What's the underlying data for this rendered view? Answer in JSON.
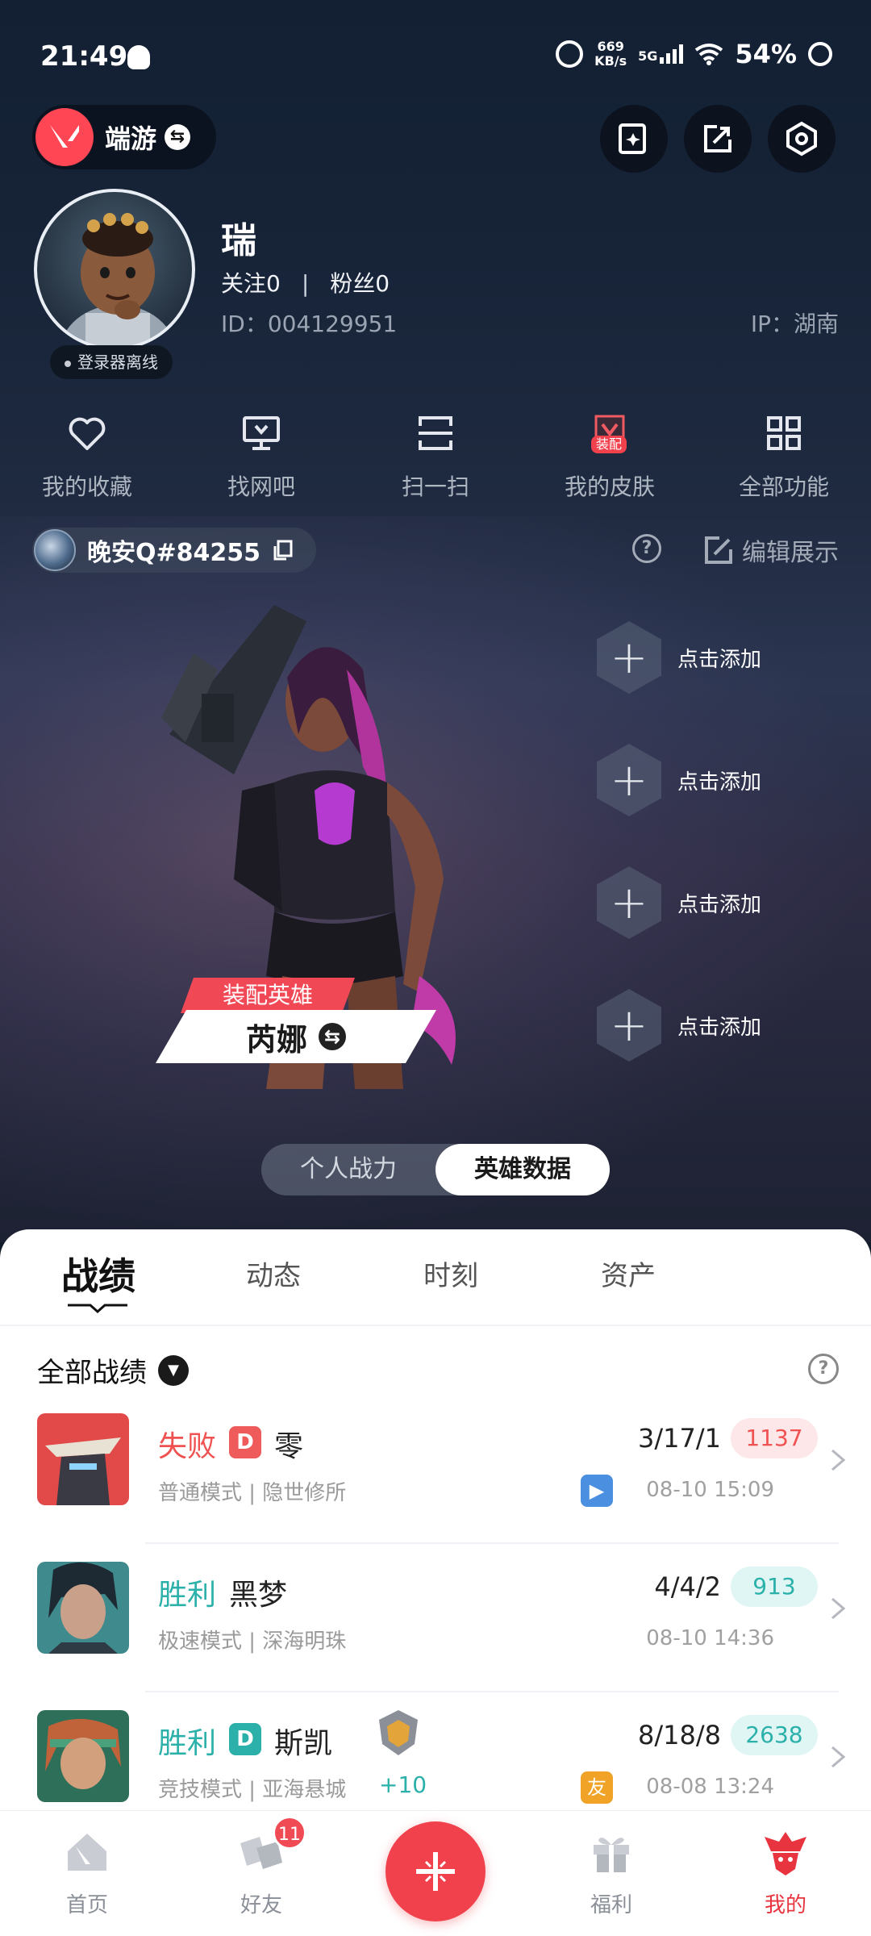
{
  "status_bar": {
    "time": "21:49",
    "net_speed_value": "669",
    "net_speed_unit": "KB/s",
    "network": "5G",
    "battery": "54%"
  },
  "top_bar": {
    "app_name": "端游"
  },
  "profile": {
    "username": "瑞",
    "follow_label": "关注",
    "follow_count": "0",
    "fans_label": "粉丝",
    "fans_count": "0",
    "id_text": "ID：004129951",
    "ip_text": "IP：湖南",
    "login_status": "登录器离线"
  },
  "functions": [
    {
      "label": "我的收藏",
      "icon": "heart-icon"
    },
    {
      "label": "找网吧",
      "icon": "monitor-icon"
    },
    {
      "label": "扫一扫",
      "icon": "scan-icon"
    },
    {
      "label": "我的皮肤",
      "icon": "skin-icon",
      "badge": "装配"
    },
    {
      "label": "全部功能",
      "icon": "grid-icon"
    }
  ],
  "game_account": {
    "name": "晚安Q#84255",
    "edit_label": "编辑展示"
  },
  "hero": {
    "tag_label": "装配英雄",
    "name": "芮娜"
  },
  "add_slots": [
    "点击添加",
    "点击添加",
    "点击添加",
    "点击添加"
  ],
  "toggle": {
    "options": [
      "个人战力",
      "英雄数据"
    ],
    "active": "英雄数据"
  },
  "tabs": {
    "items": [
      "战绩",
      "动态",
      "时刻",
      "资产"
    ],
    "active": "战绩"
  },
  "filter": {
    "label": "全部战绩"
  },
  "matches": [
    {
      "result": "失败",
      "result_type": "lose",
      "badge": "D",
      "badge_color": "#ef5a5a",
      "hero": "零",
      "meta": "普通模式 | 隐世修所",
      "kda": "3/17/1",
      "score": "1137",
      "score_style": "red",
      "time": "08-10 15:09",
      "time_badge": "video",
      "thumb_colors": [
        "#e24a4a",
        "#3a3a44"
      ]
    },
    {
      "result": "胜利",
      "result_type": "win",
      "badge": "",
      "badge_color": "",
      "hero": "黑梦",
      "meta": "极速模式 | 深海明珠",
      "kda": "4/4/2",
      "score": "913",
      "score_style": "teal",
      "time": "08-10 14:36",
      "time_badge": "",
      "thumb_colors": [
        "#3f8a8c",
        "#1e2a33"
      ]
    },
    {
      "result": "胜利",
      "result_type": "win",
      "badge": "D",
      "badge_color": "#2bb0aa",
      "hero": "斯凯",
      "meta": "竞技模式 | 亚海悬城",
      "kda": "8/18/8",
      "score": "2638",
      "score_style": "teal",
      "time": "08-08 13:24",
      "time_badge": "友",
      "rank_change": "+10",
      "thumb_colors": [
        "#c0623a",
        "#2e6f5a"
      ]
    }
  ],
  "bottom_nav": [
    {
      "label": "首页",
      "icon": "home-icon"
    },
    {
      "label": "好友",
      "icon": "friends-icon",
      "badge": "11"
    },
    {
      "label": "福利",
      "icon": "gift-icon"
    },
    {
      "label": "我的",
      "icon": "profile-icon",
      "active": true
    }
  ],
  "colors": {
    "accent": "#f0414d",
    "win": "#2bb0aa",
    "lose": "#f05252"
  }
}
